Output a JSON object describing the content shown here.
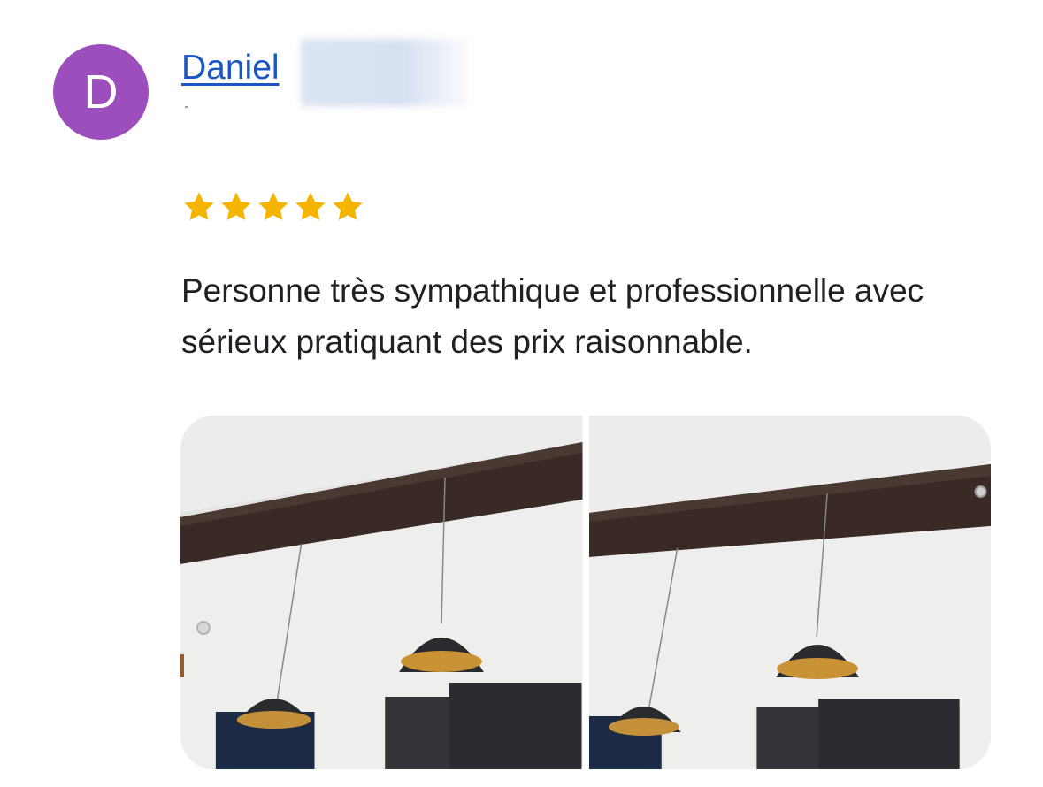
{
  "review": {
    "avatar_letter": "D",
    "avatar_color": "#9c4fbc",
    "author_name": "Daniel ",
    "author_link_color": "#1a57c2",
    "rating": 5,
    "max_rating": 5,
    "star_color": "#f4b400",
    "text": "Personne très sympathique et professionnelle avec sérieux pratiquant des prix raisonnable.",
    "photos": [
      {
        "icon": "photo-pendant-lamps"
      },
      {
        "icon": "photo-pendant-lamps"
      }
    ]
  }
}
